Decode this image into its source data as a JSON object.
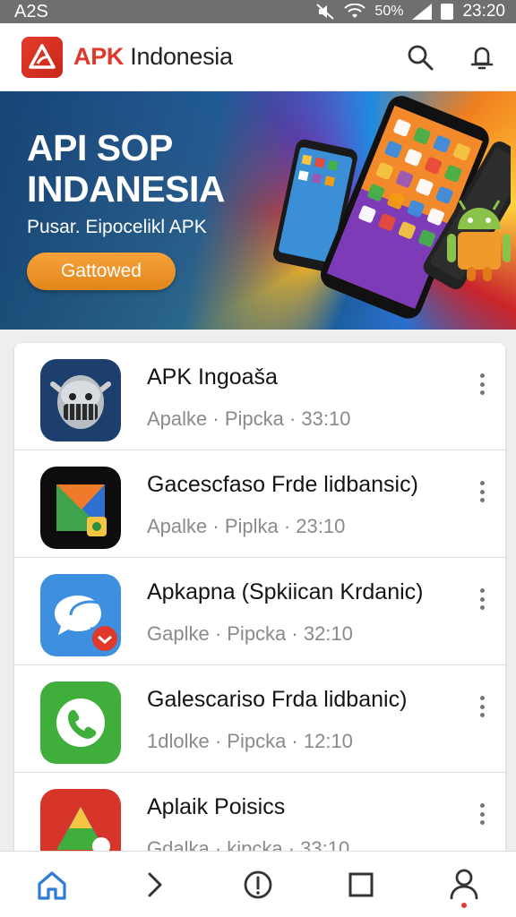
{
  "status_bar": {
    "left": "A2S",
    "battery": "50%",
    "time": "23:20"
  },
  "app_bar": {
    "brand_prefix": "APK",
    "brand_suffix": " Indonesia",
    "logo": "apk-logo-icon",
    "actions": [
      "search-icon",
      "notification-bell-icon"
    ]
  },
  "banner": {
    "title_line1": "API SOP",
    "title_line2": "INDANESIA",
    "subtitle": "Pusar. Eipocelikl APK",
    "button": "Gattowed"
  },
  "apps": [
    {
      "title": "APK Ingoaša",
      "meta": "Apalke · Pipcka · 33:10",
      "icon": "knight-helmet-icon"
    },
    {
      "title": "Gacescfaso Frde lidbansic)",
      "meta": "Apalke · Piplka · 23:10",
      "icon": "colorful-folder-icon"
    },
    {
      "title": "Apkapna (Spkiican Krdanic)",
      "meta": "Gaplke · Pipcka · 32:10",
      "icon": "chat-bubbles-icon"
    },
    {
      "title": "Galescariso Frda lidbanic)",
      "meta": "1dlolke · Pipcka · 12:10",
      "icon": "phone-call-icon"
    },
    {
      "title": "Aplaik Poisics",
      "meta": "Gdalka · kipcka · 33:10",
      "icon": "drive-triangle-icon"
    }
  ],
  "bottom_nav": [
    "home-icon",
    "chevron-right-icon",
    "info-icon",
    "square-icon",
    "profile-icon"
  ],
  "colors": {
    "brand_red": "#e0382a",
    "button_orange": "#f0962e",
    "home_active_blue": "#2f7bd6"
  }
}
